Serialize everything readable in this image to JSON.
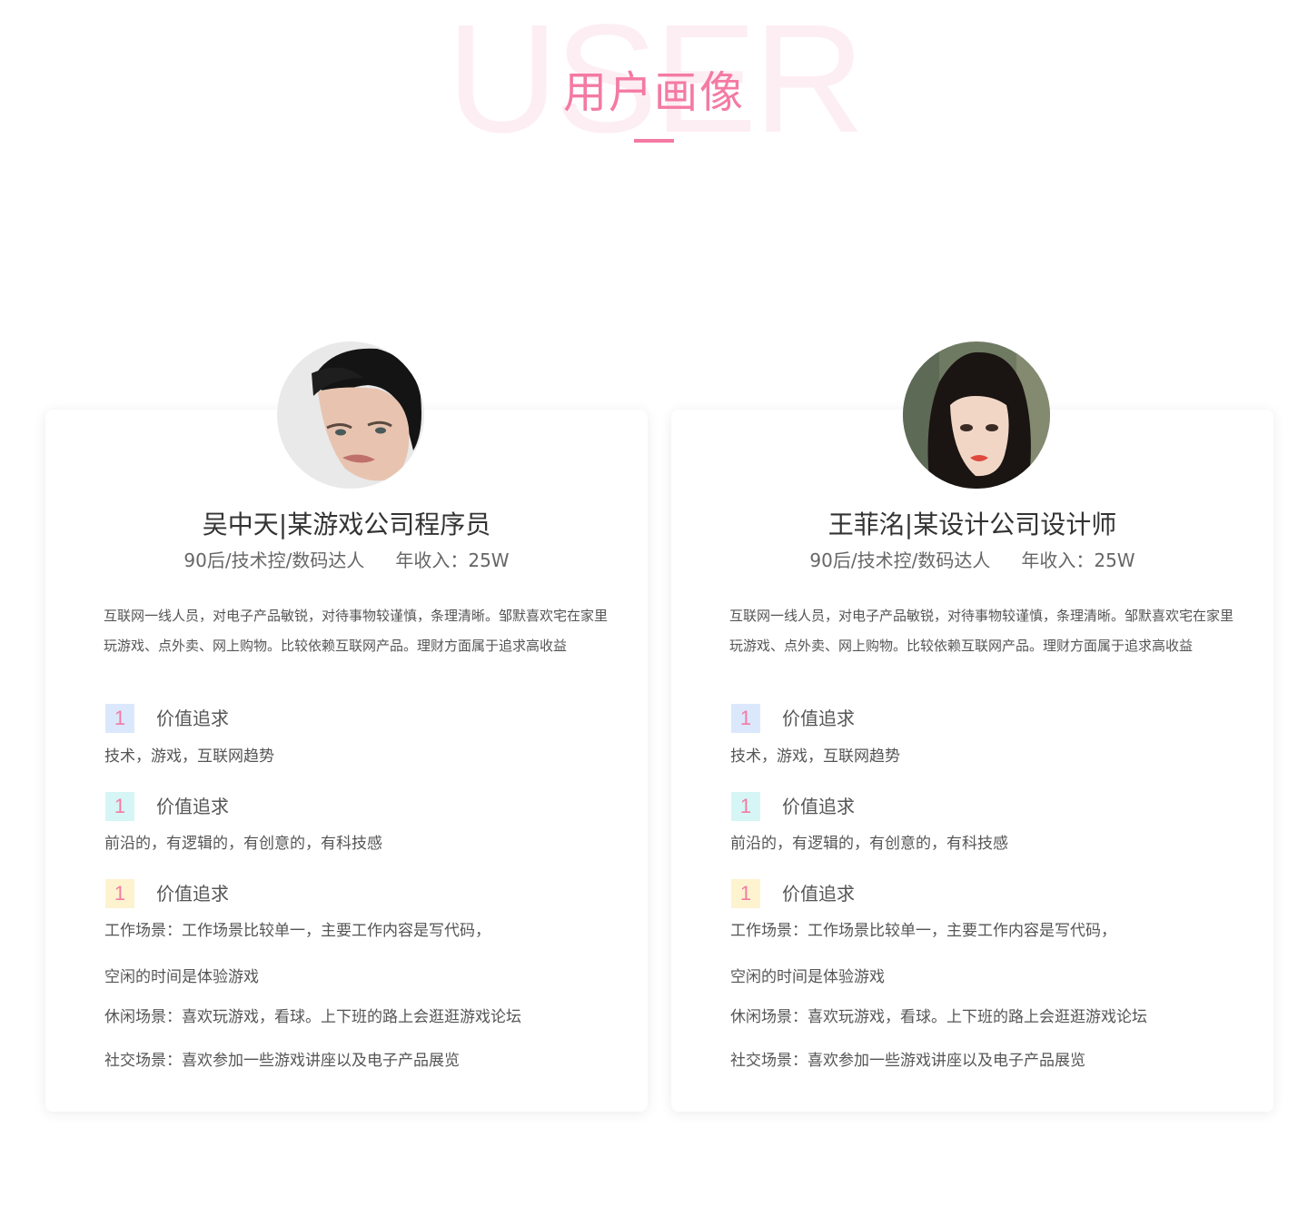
{
  "header": {
    "bg_word": "USER",
    "title": "用户画像"
  },
  "colors": {
    "accent": "#f47aa3",
    "watermark": "#fdeef3",
    "num_blue": "#dbe8fc",
    "num_cyan": "#d6f6f5",
    "num_yellow": "#fdf3cf"
  },
  "personas": [
    {
      "name": "吴中天|某游戏公司程序员",
      "tags": "90后/技术控/数码达人",
      "income": "年收入：25W",
      "avatar": "male-portrait-photo",
      "description": "互联网一线人员，对电子产品敏锐，对待事物较谨慎，条理清晰。邹默喜欢宅在家里玩游戏、点外卖、网上购物。比较依赖互联网产品。理财方面属于追求高收益",
      "sections": [
        {
          "number": "1",
          "title": "价值追求",
          "text": "技术，游戏，互联网趋势"
        },
        {
          "number": "1",
          "title": "价值追求",
          "text": "前沿的，有逻辑的，有创意的，有科技感"
        },
        {
          "number": "1",
          "title": "价值追求",
          "text": "工作场景：工作场景比较单一，主要工作内容是写代码，"
        }
      ],
      "extra_lines": [
        "空闲的时间是体验游戏",
        "休闲场景：喜欢玩游戏，看球。上下班的路上会逛逛游戏论坛",
        "社交场景：喜欢参加一些游戏讲座以及电子产品展览"
      ]
    },
    {
      "name": "王菲洺|某设计公司设计师",
      "tags": "90后/技术控/数码达人",
      "income": "年收入：25W",
      "avatar": "female-portrait-photo",
      "description": "互联网一线人员，对电子产品敏锐，对待事物较谨慎，条理清晰。邹默喜欢宅在家里玩游戏、点外卖、网上购物。比较依赖互联网产品。理财方面属于追求高收益",
      "sections": [
        {
          "number": "1",
          "title": "价值追求",
          "text": "技术，游戏，互联网趋势"
        },
        {
          "number": "1",
          "title": "价值追求",
          "text": "前沿的，有逻辑的，有创意的，有科技感"
        },
        {
          "number": "1",
          "title": "价值追求",
          "text": "工作场景：工作场景比较单一，主要工作内容是写代码，"
        }
      ],
      "extra_lines": [
        "空闲的时间是体验游戏",
        "休闲场景：喜欢玩游戏，看球。上下班的路上会逛逛游戏论坛",
        "社交场景：喜欢参加一些游戏讲座以及电子产品展览"
      ]
    }
  ]
}
